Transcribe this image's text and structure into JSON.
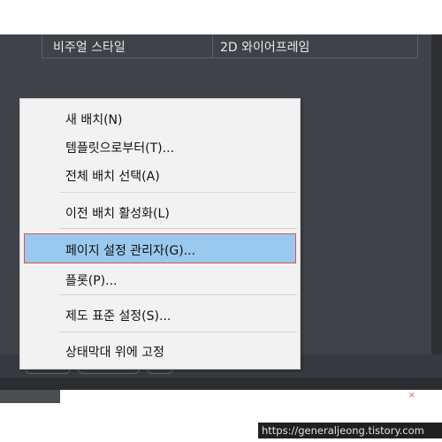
{
  "properties": {
    "label": "비주얼 스타일",
    "value": "2D 와이어프레임"
  },
  "context_menu": {
    "items": [
      {
        "label": "새 배치(N)"
      },
      {
        "label": "템플릿으로부터(T)..."
      },
      {
        "label": "전체 배치 선택(A)"
      },
      {
        "label": "이전 배치 활성화(L)"
      },
      {
        "label": "페이지 설정 관리자(G)...",
        "highlighted": true
      },
      {
        "label": "플롯(P)..."
      },
      {
        "label": "제도 표준 설정(S)..."
      },
      {
        "label": "상태막대 위에 고정"
      }
    ]
  },
  "watermark": "https://generaljeong.tistory.com",
  "colors": {
    "highlight": "#99c9ef",
    "highlight_border": "#e05050",
    "dark_background": "#3f4248",
    "menu_background": "#f2f2f2"
  }
}
